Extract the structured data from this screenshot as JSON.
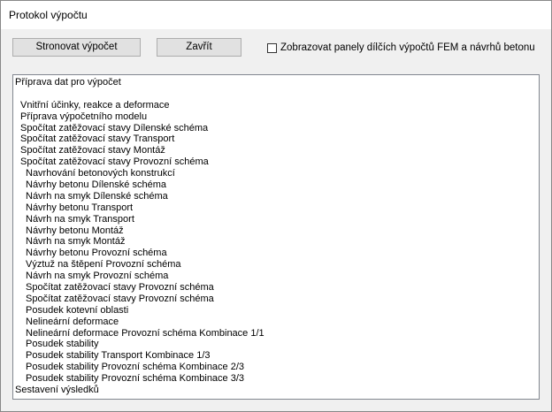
{
  "window": {
    "title": "Protokol výpočtu"
  },
  "toolbar": {
    "recalc_label": "Stronovat výpočet",
    "close_label": "Zavřít",
    "checkbox_label": "Zobrazovat panely dílčích výpočtů FEM a návrhů betonu",
    "checkbox_checked": false
  },
  "log": {
    "lines": [
      {
        "text": "Příprava dat pro výpočet",
        "indent": 0
      },
      {
        "text": "",
        "indent": 0
      },
      {
        "text": "Vnitřní účinky, reakce a deformace",
        "indent": 1
      },
      {
        "text": "Příprava výpočetního modelu",
        "indent": 1
      },
      {
        "text": "Spočítat zatěžovací stavy Dílenské schéma",
        "indent": 1
      },
      {
        "text": "Spočítat zatěžovací stavy Transport",
        "indent": 1
      },
      {
        "text": "Spočítat zatěžovací stavy Montáž",
        "indent": 1
      },
      {
        "text": "Spočítat zatěžovací stavy Provozní schéma",
        "indent": 1
      },
      {
        "text": "Navrhování betonových konstrukcí",
        "indent": 2
      },
      {
        "text": "Návrhy betonu Dílenské schéma",
        "indent": 2
      },
      {
        "text": "Návrh na smyk Dílenské schéma",
        "indent": 2
      },
      {
        "text": "Návrhy betonu Transport",
        "indent": 2
      },
      {
        "text": "Návrh na smyk Transport",
        "indent": 2
      },
      {
        "text": "Návrhy betonu Montáž",
        "indent": 2
      },
      {
        "text": "Návrh na smyk Montáž",
        "indent": 2
      },
      {
        "text": "Návrhy betonu Provozní schéma",
        "indent": 2
      },
      {
        "text": "Výztuž na štěpení Provozní schéma",
        "indent": 2
      },
      {
        "text": "Návrh na smyk Provozní schéma",
        "indent": 2
      },
      {
        "text": "Spočítat zatěžovací stavy Provozní schéma",
        "indent": 2
      },
      {
        "text": "Spočítat zatěžovací stavy Provozní schéma",
        "indent": 2
      },
      {
        "text": "Posudek kotevní oblasti",
        "indent": 2
      },
      {
        "text": "Nelineární deformace",
        "indent": 2
      },
      {
        "text": "Nelineární deformace Provozní schéma Kombinace 1/1",
        "indent": 2
      },
      {
        "text": "Posudek stability",
        "indent": 2
      },
      {
        "text": "Posudek stability Transport Kombinace 1/3",
        "indent": 2
      },
      {
        "text": "Posudek stability Provozní schéma Kombinace 2/3",
        "indent": 2
      },
      {
        "text": "Posudek stability Provozní schéma Kombinace 3/3",
        "indent": 2
      },
      {
        "text": "Sestavení výsledků",
        "indent": 0
      }
    ]
  }
}
